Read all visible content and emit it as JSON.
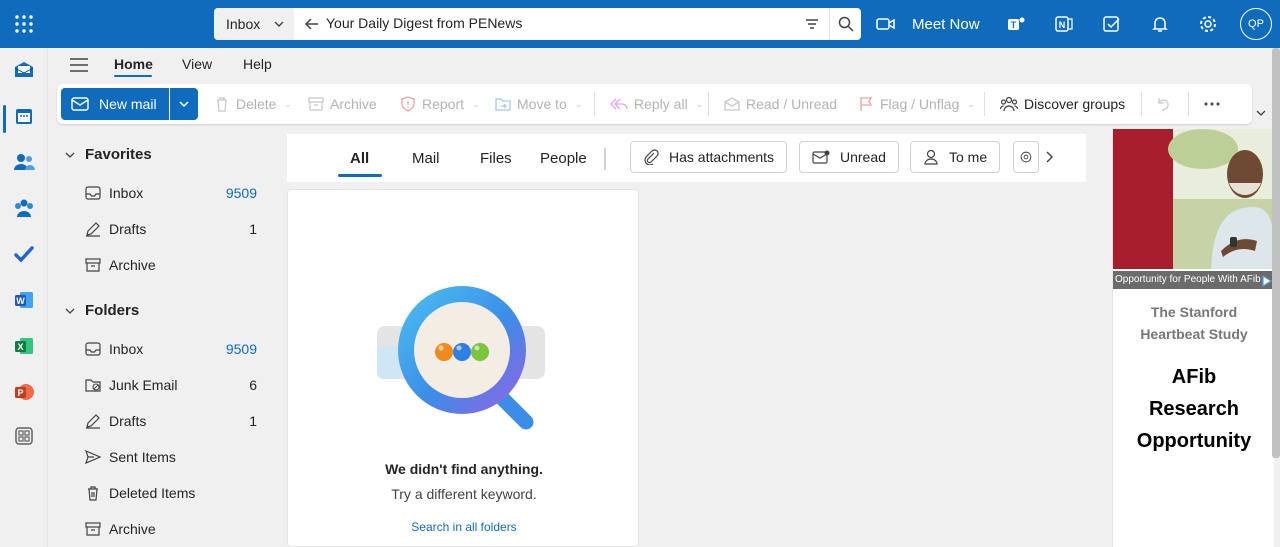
{
  "header": {
    "scope": "Inbox",
    "search_query": "Your Daily Digest from PENews",
    "meet_now": "Meet Now",
    "avatar_initials": "QP",
    "brand_color": "#0f6cbd"
  },
  "ribbon_tabs": [
    "Home",
    "View",
    "Help"
  ],
  "ribbon": {
    "new_mail": "New mail",
    "delete": "Delete",
    "archive": "Archive",
    "report": "Report",
    "move_to": "Move to",
    "reply_all": "Reply all",
    "read_unread": "Read / Unread",
    "flag_unflag": "Flag / Unflag",
    "discover_groups": "Discover groups"
  },
  "folders": {
    "favorites_label": "Favorites",
    "favorites": [
      {
        "name": "Inbox",
        "count": "9509"
      },
      {
        "name": "Drafts",
        "count": "1"
      },
      {
        "name": "Archive",
        "count": ""
      }
    ],
    "folders_label": "Folders",
    "items": [
      {
        "name": "Inbox",
        "count": "9509"
      },
      {
        "name": "Junk Email",
        "count": "6"
      },
      {
        "name": "Drafts",
        "count": "1"
      },
      {
        "name": "Sent Items",
        "count": ""
      },
      {
        "name": "Deleted Items",
        "count": ""
      },
      {
        "name": "Archive",
        "count": ""
      }
    ]
  },
  "filters": {
    "tabs": [
      "All",
      "Mail",
      "Files",
      "People"
    ],
    "pills": [
      "Has attachments",
      "Unread",
      "To me"
    ]
  },
  "empty_state": {
    "title": "We didn't find anything.",
    "subtitle": "Try a different keyword.",
    "link": "Search in all folders"
  },
  "ad": {
    "caption": "Opportunity for People With AFib",
    "sponsor_line1": "The Stanford",
    "sponsor_line2": "Heartbeat Study",
    "headline_line1": "AFib",
    "headline_line2": "Research",
    "headline_line3": "Opportunity"
  }
}
